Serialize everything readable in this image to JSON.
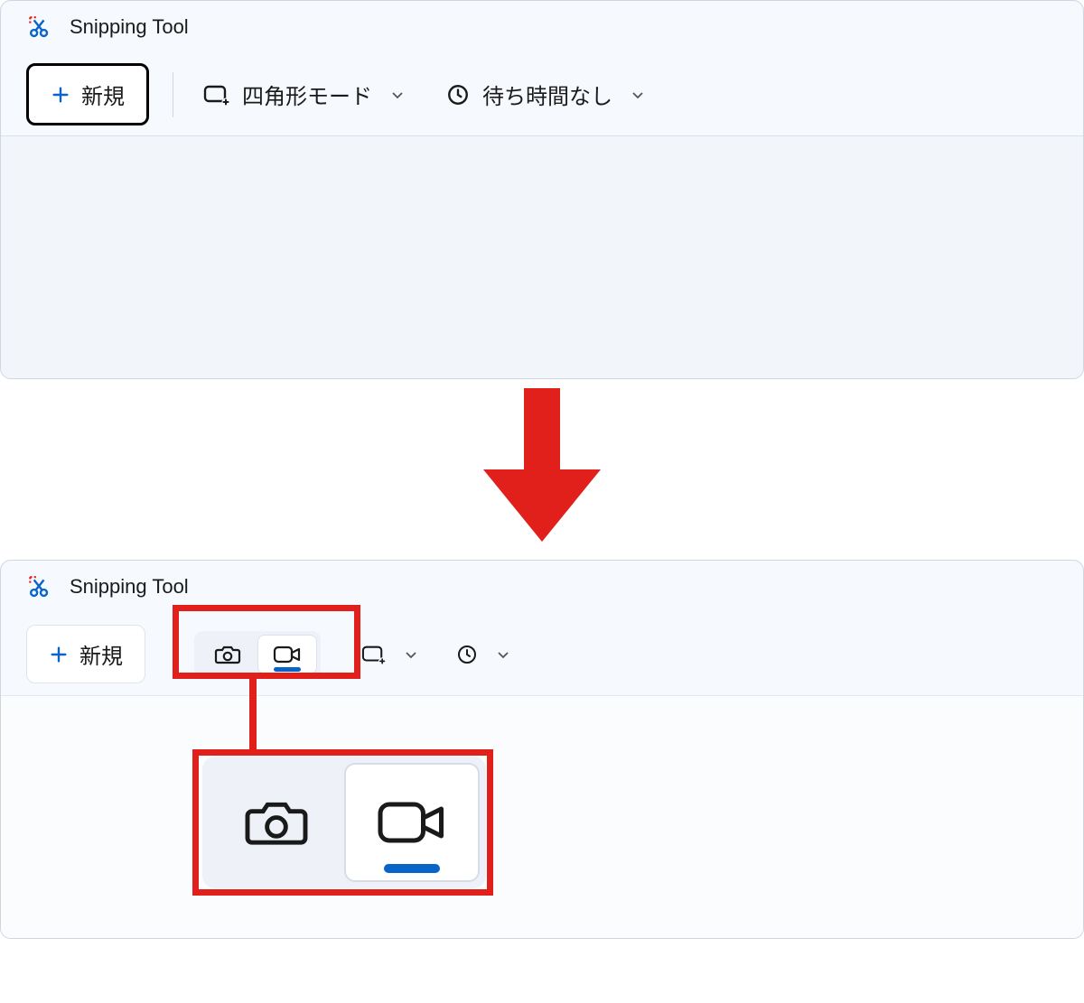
{
  "app": {
    "title": "Snipping Tool"
  },
  "toolbar": {
    "new_label": "新規",
    "mode_label": "四角形モード",
    "delay_label": "待ち時間なし"
  },
  "colors": {
    "accent": "#0a63c9",
    "highlight": "#e1201c"
  }
}
